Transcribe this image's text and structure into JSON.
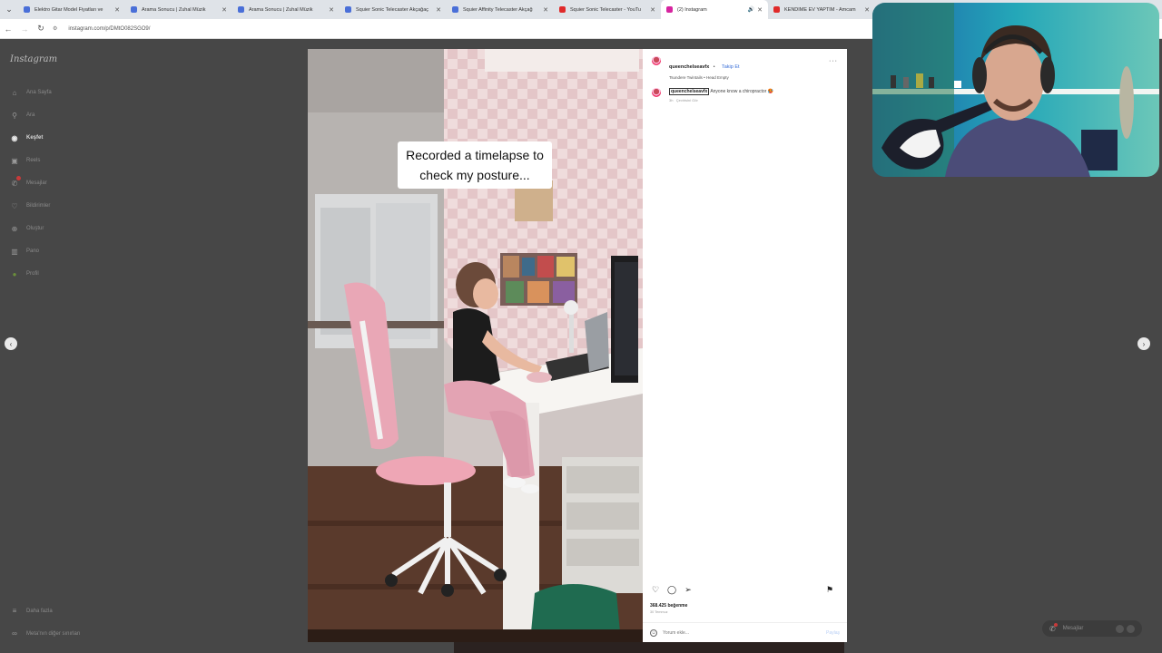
{
  "browser": {
    "tabs": [
      {
        "title": "Elektro Gitar Model Fiyatları ve",
        "favicon_color": "#4a6fd8",
        "active": false
      },
      {
        "title": "Arama Sonucu | Zuhal Müzik",
        "favicon_color": "#4a6fd8",
        "active": false
      },
      {
        "title": "Arama Sonucu | Zuhal Müzik",
        "favicon_color": "#4a6fd8",
        "active": false
      },
      {
        "title": "Squier Sonic Telecaster Akçağaç",
        "favicon_color": "#4a6fd8",
        "active": false
      },
      {
        "title": "Squier Affinity Telecaster Akçağ",
        "favicon_color": "#4a6fd8",
        "active": false
      },
      {
        "title": "Squier Sonic Telecaster - YouTu",
        "favicon_color": "#e02a2a",
        "active": false
      },
      {
        "title": "(2) Instagram",
        "favicon_color": "#d6249f",
        "active": true
      },
      {
        "title": "KENDİME EV YAPTIM - Amcam",
        "favicon_color": "#e02a2a",
        "active": false
      }
    ],
    "url": "instagram.com/p/DMtO082SGO9/"
  },
  "sidebar": {
    "logo": "Instagram",
    "items": [
      {
        "label": "Ana Sayfa",
        "icon": "home-icon",
        "glyph": "⌂",
        "active": false
      },
      {
        "label": "Ara",
        "icon": "search-icon",
        "glyph": "⚲",
        "active": false
      },
      {
        "label": "Keşfet",
        "icon": "compass-icon",
        "glyph": "◉",
        "active": true
      },
      {
        "label": "Reels",
        "icon": "reels-icon",
        "glyph": "▣",
        "active": false
      },
      {
        "label": "Mesajlar",
        "icon": "messenger-icon",
        "glyph": "✆",
        "active": false,
        "badge": true
      },
      {
        "label": "Bildirimler",
        "icon": "heart-icon",
        "glyph": "♡",
        "active": false
      },
      {
        "label": "Oluştur",
        "icon": "plus-square-icon",
        "glyph": "⊕",
        "active": false
      },
      {
        "label": "Pano",
        "icon": "dashboard-icon",
        "glyph": "▥",
        "active": false
      },
      {
        "label": "Profil",
        "icon": "profile-avatar-icon",
        "glyph": "●",
        "active": false
      }
    ],
    "bottom": [
      {
        "label": "Daha fazla",
        "icon": "menu-icon",
        "glyph": "≡"
      },
      {
        "label": "Meta'nın diğer sınırları",
        "icon": "meta-icon",
        "glyph": "∞"
      }
    ]
  },
  "post": {
    "overlay_caption": "Recorded a timelapse to check my posture...",
    "username": "queenchelseavfx",
    "follow_label": "Takip Et",
    "separator": "•",
    "music": "Tsundere Twintails • Head Empty",
    "more_label": "···",
    "comment": {
      "username": "queenchelseavfx",
      "text": "Anyone know a chiropractor 🥵",
      "age": "3h",
      "translate": "Çevirisini Gör"
    },
    "likes": "368.425 beğenme",
    "date": "30 Temmuz",
    "comment_placeholder": "Yorum ekle...",
    "share_label": "Paylaş"
  },
  "messages_pill": {
    "label": "Mesajlar"
  },
  "colors": {
    "accent_blue": "#3a6fd8",
    "page_bg": "#474747",
    "badge_red": "#c83a3a"
  }
}
